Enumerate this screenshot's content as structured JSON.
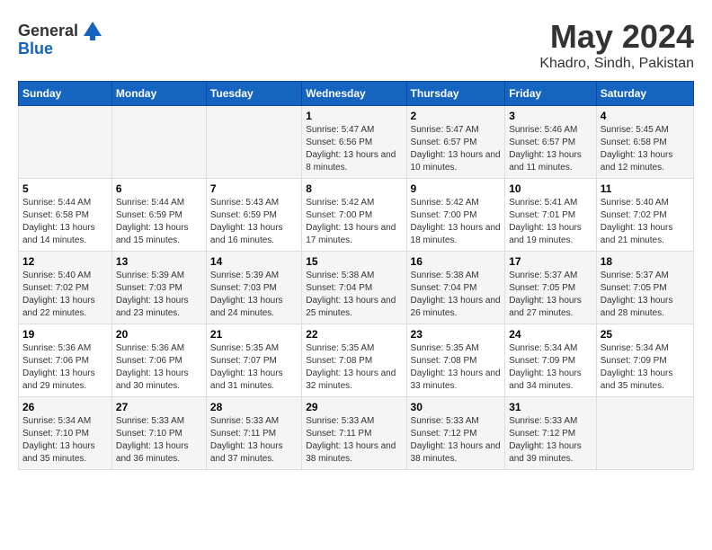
{
  "header": {
    "logo_general": "General",
    "logo_blue": "Blue",
    "title": "May 2024",
    "subtitle": "Khadro, Sindh, Pakistan"
  },
  "days_of_week": [
    "Sunday",
    "Monday",
    "Tuesday",
    "Wednesday",
    "Thursday",
    "Friday",
    "Saturday"
  ],
  "weeks": [
    [
      {
        "day": "",
        "sunrise": "",
        "sunset": "",
        "daylight": ""
      },
      {
        "day": "",
        "sunrise": "",
        "sunset": "",
        "daylight": ""
      },
      {
        "day": "",
        "sunrise": "",
        "sunset": "",
        "daylight": ""
      },
      {
        "day": "1",
        "sunrise": "Sunrise: 5:47 AM",
        "sunset": "Sunset: 6:56 PM",
        "daylight": "Daylight: 13 hours and 8 minutes."
      },
      {
        "day": "2",
        "sunrise": "Sunrise: 5:47 AM",
        "sunset": "Sunset: 6:57 PM",
        "daylight": "Daylight: 13 hours and 10 minutes."
      },
      {
        "day": "3",
        "sunrise": "Sunrise: 5:46 AM",
        "sunset": "Sunset: 6:57 PM",
        "daylight": "Daylight: 13 hours and 11 minutes."
      },
      {
        "day": "4",
        "sunrise": "Sunrise: 5:45 AM",
        "sunset": "Sunset: 6:58 PM",
        "daylight": "Daylight: 13 hours and 12 minutes."
      }
    ],
    [
      {
        "day": "5",
        "sunrise": "Sunrise: 5:44 AM",
        "sunset": "Sunset: 6:58 PM",
        "daylight": "Daylight: 13 hours and 14 minutes."
      },
      {
        "day": "6",
        "sunrise": "Sunrise: 5:44 AM",
        "sunset": "Sunset: 6:59 PM",
        "daylight": "Daylight: 13 hours and 15 minutes."
      },
      {
        "day": "7",
        "sunrise": "Sunrise: 5:43 AM",
        "sunset": "Sunset: 6:59 PM",
        "daylight": "Daylight: 13 hours and 16 minutes."
      },
      {
        "day": "8",
        "sunrise": "Sunrise: 5:42 AM",
        "sunset": "Sunset: 7:00 PM",
        "daylight": "Daylight: 13 hours and 17 minutes."
      },
      {
        "day": "9",
        "sunrise": "Sunrise: 5:42 AM",
        "sunset": "Sunset: 7:00 PM",
        "daylight": "Daylight: 13 hours and 18 minutes."
      },
      {
        "day": "10",
        "sunrise": "Sunrise: 5:41 AM",
        "sunset": "Sunset: 7:01 PM",
        "daylight": "Daylight: 13 hours and 19 minutes."
      },
      {
        "day": "11",
        "sunrise": "Sunrise: 5:40 AM",
        "sunset": "Sunset: 7:02 PM",
        "daylight": "Daylight: 13 hours and 21 minutes."
      }
    ],
    [
      {
        "day": "12",
        "sunrise": "Sunrise: 5:40 AM",
        "sunset": "Sunset: 7:02 PM",
        "daylight": "Daylight: 13 hours and 22 minutes."
      },
      {
        "day": "13",
        "sunrise": "Sunrise: 5:39 AM",
        "sunset": "Sunset: 7:03 PM",
        "daylight": "Daylight: 13 hours and 23 minutes."
      },
      {
        "day": "14",
        "sunrise": "Sunrise: 5:39 AM",
        "sunset": "Sunset: 7:03 PM",
        "daylight": "Daylight: 13 hours and 24 minutes."
      },
      {
        "day": "15",
        "sunrise": "Sunrise: 5:38 AM",
        "sunset": "Sunset: 7:04 PM",
        "daylight": "Daylight: 13 hours and 25 minutes."
      },
      {
        "day": "16",
        "sunrise": "Sunrise: 5:38 AM",
        "sunset": "Sunset: 7:04 PM",
        "daylight": "Daylight: 13 hours and 26 minutes."
      },
      {
        "day": "17",
        "sunrise": "Sunrise: 5:37 AM",
        "sunset": "Sunset: 7:05 PM",
        "daylight": "Daylight: 13 hours and 27 minutes."
      },
      {
        "day": "18",
        "sunrise": "Sunrise: 5:37 AM",
        "sunset": "Sunset: 7:05 PM",
        "daylight": "Daylight: 13 hours and 28 minutes."
      }
    ],
    [
      {
        "day": "19",
        "sunrise": "Sunrise: 5:36 AM",
        "sunset": "Sunset: 7:06 PM",
        "daylight": "Daylight: 13 hours and 29 minutes."
      },
      {
        "day": "20",
        "sunrise": "Sunrise: 5:36 AM",
        "sunset": "Sunset: 7:06 PM",
        "daylight": "Daylight: 13 hours and 30 minutes."
      },
      {
        "day": "21",
        "sunrise": "Sunrise: 5:35 AM",
        "sunset": "Sunset: 7:07 PM",
        "daylight": "Daylight: 13 hours and 31 minutes."
      },
      {
        "day": "22",
        "sunrise": "Sunrise: 5:35 AM",
        "sunset": "Sunset: 7:08 PM",
        "daylight": "Daylight: 13 hours and 32 minutes."
      },
      {
        "day": "23",
        "sunrise": "Sunrise: 5:35 AM",
        "sunset": "Sunset: 7:08 PM",
        "daylight": "Daylight: 13 hours and 33 minutes."
      },
      {
        "day": "24",
        "sunrise": "Sunrise: 5:34 AM",
        "sunset": "Sunset: 7:09 PM",
        "daylight": "Daylight: 13 hours and 34 minutes."
      },
      {
        "day": "25",
        "sunrise": "Sunrise: 5:34 AM",
        "sunset": "Sunset: 7:09 PM",
        "daylight": "Daylight: 13 hours and 35 minutes."
      }
    ],
    [
      {
        "day": "26",
        "sunrise": "Sunrise: 5:34 AM",
        "sunset": "Sunset: 7:10 PM",
        "daylight": "Daylight: 13 hours and 35 minutes."
      },
      {
        "day": "27",
        "sunrise": "Sunrise: 5:33 AM",
        "sunset": "Sunset: 7:10 PM",
        "daylight": "Daylight: 13 hours and 36 minutes."
      },
      {
        "day": "28",
        "sunrise": "Sunrise: 5:33 AM",
        "sunset": "Sunset: 7:11 PM",
        "daylight": "Daylight: 13 hours and 37 minutes."
      },
      {
        "day": "29",
        "sunrise": "Sunrise: 5:33 AM",
        "sunset": "Sunset: 7:11 PM",
        "daylight": "Daylight: 13 hours and 38 minutes."
      },
      {
        "day": "30",
        "sunrise": "Sunrise: 5:33 AM",
        "sunset": "Sunset: 7:12 PM",
        "daylight": "Daylight: 13 hours and 38 minutes."
      },
      {
        "day": "31",
        "sunrise": "Sunrise: 5:33 AM",
        "sunset": "Sunset: 7:12 PM",
        "daylight": "Daylight: 13 hours and 39 minutes."
      },
      {
        "day": "",
        "sunrise": "",
        "sunset": "",
        "daylight": ""
      }
    ]
  ]
}
